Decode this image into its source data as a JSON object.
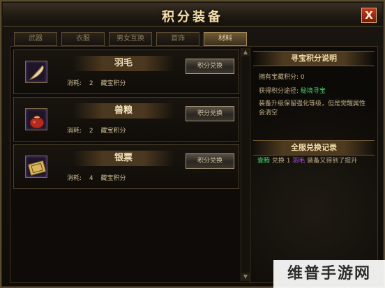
{
  "window": {
    "title": "积分装备",
    "close_label": "X"
  },
  "tabs": [
    {
      "label": "武器",
      "active": false
    },
    {
      "label": "衣服",
      "active": false
    },
    {
      "label": "男女互换",
      "active": false
    },
    {
      "label": "首饰",
      "active": false
    },
    {
      "label": "材料",
      "active": true
    }
  ],
  "items": [
    {
      "name": "羽毛",
      "icon": "feather-icon",
      "cost_label": "消耗:",
      "cost_value": "2",
      "cost_unit": "藏宝积分",
      "button_label": "积分兑换"
    },
    {
      "name": "兽粮",
      "icon": "pouch-icon",
      "cost_label": "消耗:",
      "cost_value": "2",
      "cost_unit": "藏宝积分",
      "button_label": "积分兑换"
    },
    {
      "name": "银票",
      "icon": "banknote-icon",
      "cost_label": "消耗:",
      "cost_value": "4",
      "cost_unit": "藏宝积分",
      "button_label": "积分兑换"
    }
  ],
  "side": {
    "points_header": "寻宝积分说明",
    "points_owned_label": "拥有宝藏积分:",
    "points_owned_value": "0",
    "obtain_label": "获得积分途径:",
    "obtain_value": "秘境寻宝",
    "description": "装备升级保留强化等级，但是觉醒属性会清空",
    "records_header": "全服兑换记录",
    "record_name": "壹腾",
    "record_text_1": "兑换 1",
    "record_item": "羽毛",
    "record_text_2": "装备又得到了提升"
  },
  "watermark": "维普手游网",
  "scroll": {
    "up": "▲",
    "down": "▼"
  }
}
